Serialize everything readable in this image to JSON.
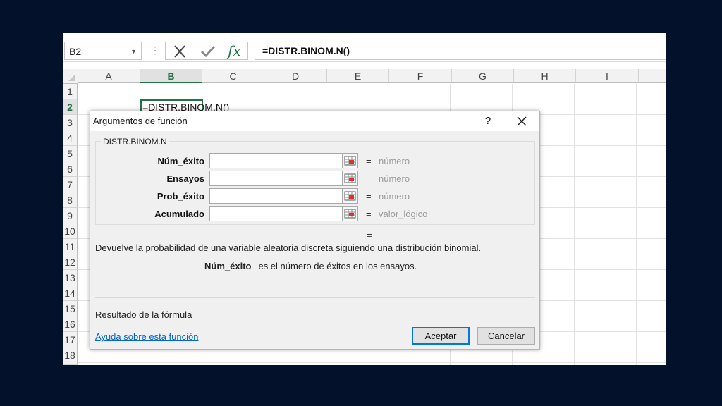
{
  "formula_bar": {
    "name_box": "B2",
    "separator": "⋮",
    "cancel_icon": "close-x-icon",
    "enter_icon": "checkmark-icon",
    "fx_label": "fx",
    "formula": "=DISTR.BINOM.N()"
  },
  "sheet": {
    "columns": [
      "A",
      "B",
      "C",
      "D",
      "E",
      "F",
      "G",
      "H",
      "I"
    ],
    "rows": [
      "1",
      "2",
      "3",
      "4",
      "5",
      "6",
      "7",
      "8",
      "9",
      "10",
      "11",
      "12",
      "13",
      "14",
      "15",
      "16",
      "17",
      "18"
    ],
    "selected_column": "B",
    "selected_row": "2",
    "active_cell_text": "=DISTR.BINOM.N()",
    "header_selected_color": "#217346"
  },
  "dialog": {
    "title": "Argumentos de función",
    "help_button": "?",
    "close_button": "✕",
    "function_name": "DISTR.BINOM.N",
    "arguments": [
      {
        "label": "Núm_éxito",
        "value": "",
        "equals": "=",
        "hint": "número"
      },
      {
        "label": "Ensayos",
        "value": "",
        "equals": "=",
        "hint": "número"
      },
      {
        "label": "Prob_éxito",
        "value": "",
        "equals": "=",
        "hint": "número"
      },
      {
        "label": "Acumulado",
        "value": "",
        "equals": "=",
        "hint": "valor_lógico"
      }
    ],
    "result_equals": "=",
    "description": "Devuelve la probabilidad de una variable aleatoria discreta siguiendo una distribución binomial.",
    "arg_description_name": "Núm_éxito",
    "arg_description_text": "es el número de éxitos en los ensayos.",
    "result_label": "Resultado de la fórmula =",
    "help_link": "Ayuda sobre esta función",
    "ok_button": "Aceptar",
    "cancel_button": "Cancelar",
    "border_color": "#e8b33c"
  }
}
